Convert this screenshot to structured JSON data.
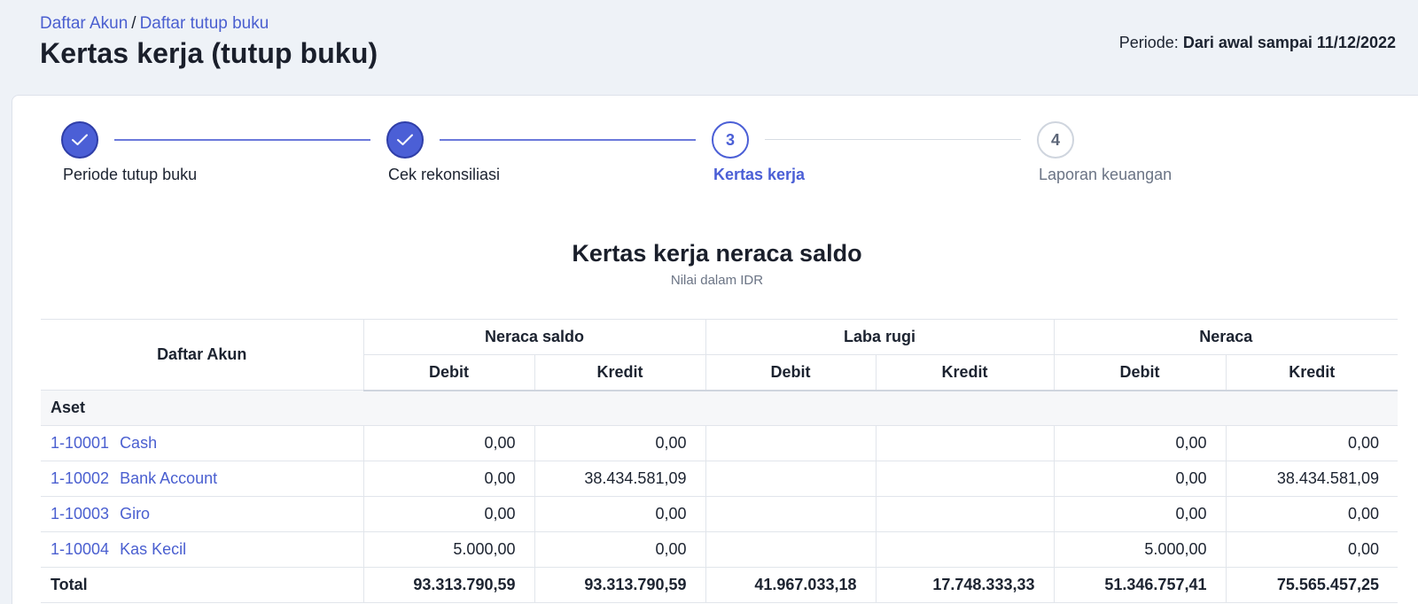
{
  "breadcrumb": {
    "items": [
      "Daftar Akun",
      "Daftar tutup buku"
    ],
    "separator": "/"
  },
  "page_title": "Kertas kerja (tutup buku)",
  "periode": {
    "label": "Periode:",
    "value": "Dari awal sampai 11/12/2022"
  },
  "stepper": {
    "steps": [
      {
        "number": "1",
        "label": "Periode tutup buku",
        "state": "done",
        "icon": "check-icon"
      },
      {
        "number": "2",
        "label": "Cek rekonsiliasi",
        "state": "done",
        "icon": "check-icon"
      },
      {
        "number": "3",
        "label": "Kertas kerja",
        "state": "current"
      },
      {
        "number": "4",
        "label": "Laporan keuangan",
        "state": "future"
      }
    ]
  },
  "worksheet": {
    "title": "Kertas kerja neraca saldo",
    "subtitle": "Nilai dalam IDR",
    "account_header": "Daftar Akun",
    "column_groups": [
      "Neraca saldo",
      "Laba rugi",
      "Neraca"
    ],
    "sub_columns": [
      "Debit",
      "Kredit",
      "Debit",
      "Kredit",
      "Debit",
      "Kredit"
    ],
    "group_name": "Aset",
    "rows": [
      {
        "code": "1-10001",
        "name": "Cash",
        "values": [
          "0,00",
          "0,00",
          "",
          "",
          "0,00",
          "0,00"
        ]
      },
      {
        "code": "1-10002",
        "name": "Bank Account",
        "values": [
          "0,00",
          "38.434.581,09",
          "",
          "",
          "0,00",
          "38.434.581,09"
        ]
      },
      {
        "code": "1-10003",
        "name": "Giro",
        "values": [
          "0,00",
          "0,00",
          "",
          "",
          "0,00",
          "0,00"
        ]
      },
      {
        "code": "1-10004",
        "name": "Kas Kecil",
        "values": [
          "5.000,00",
          "0,00",
          "",
          "",
          "5.000,00",
          "0,00"
        ]
      }
    ],
    "total": {
      "label": "Total",
      "values": [
        "93.313.790,59",
        "93.313.790,59",
        "41.967.033,18",
        "17.748.333,33",
        "51.346.757,41",
        "75.565.457,25"
      ]
    }
  },
  "colors": {
    "accent": "#4b5fd6",
    "link": "#4a5fd0",
    "page_background": "#eef2f7"
  }
}
